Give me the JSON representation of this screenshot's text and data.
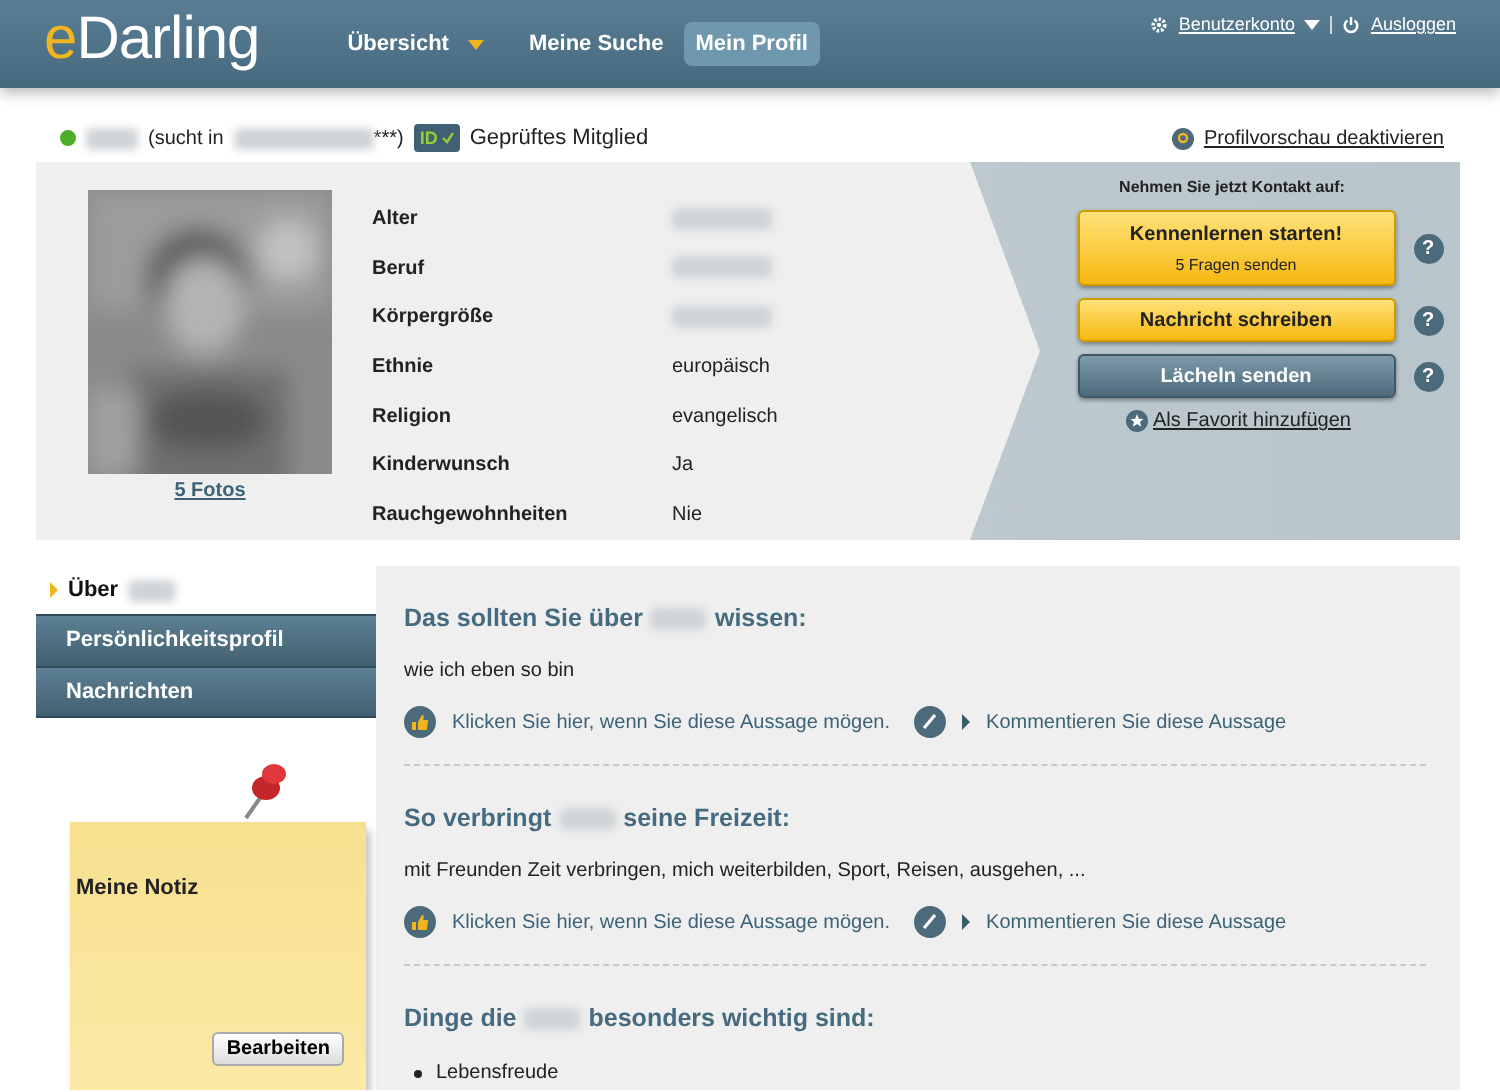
{
  "header": {
    "logo": [
      "e",
      "Darling"
    ],
    "nav": [
      {
        "label": "Übersicht",
        "selected": false,
        "dropdown": true
      },
      {
        "label": "Meine Suche",
        "selected": false,
        "dropdown": false
      },
      {
        "label": "Mein Profil",
        "selected": true,
        "dropdown": false
      }
    ],
    "account": "Benutzerkonto",
    "logout": "Ausloggen"
  },
  "status": {
    "online": true,
    "search_prefix": "(sucht in",
    "search_suffix": "***)",
    "id_badge": "ID",
    "verified": "Geprüftes Mitglied",
    "preview_link": "Profilvorschau deaktivieren"
  },
  "profile": {
    "photos_link": "5 Fotos",
    "attributes": [
      {
        "label": "Alter"
      },
      {
        "label": "Beruf"
      },
      {
        "label": "Körpergröße"
      },
      {
        "label": "Ethnie",
        "value": "europäisch"
      },
      {
        "label": "Religion",
        "value": "evangelisch"
      },
      {
        "label": "Kinderwunsch",
        "value": "Ja"
      },
      {
        "label": "Rauchgewohnheiten",
        "value": "Nie"
      }
    ],
    "contact": {
      "title": "Nehmen Sie jetzt Kontakt auf:",
      "buttons": [
        {
          "kind": "primary",
          "label": "Kennenlernen starten!",
          "sub": "5 Fragen senden",
          "help": "?"
        },
        {
          "kind": "primary",
          "label": "Nachricht schreiben",
          "help": "?"
        },
        {
          "kind": "secondary",
          "label": "Lächeln senden",
          "help": "?"
        }
      ],
      "favorite": "Als Favorit hinzufügen"
    }
  },
  "sidebar": {
    "items": [
      {
        "label": "Über",
        "selected": true
      },
      {
        "label": "Persönlichkeitsprofil",
        "selected": false
      },
      {
        "label": "Nachrichten",
        "selected": false
      }
    ],
    "note": {
      "title": "Meine Notiz",
      "button": "Bearbeiten"
    }
  },
  "sections": [
    {
      "heading": [
        "Das sollten Sie über",
        "wissen:"
      ],
      "text": "wie ich eben so bin",
      "like": "Klicken Sie hier, wenn Sie diese Aussage mögen.",
      "comment": "Kommentieren Sie diese Aussage"
    },
    {
      "heading": [
        "So verbringt",
        "seine Freizeit:"
      ],
      "text": "mit Freunden Zeit verbringen, mich weiterbilden, Sport, Reisen, ausgehen, ...",
      "like": "Klicken Sie hier, wenn Sie diese Aussage mögen.",
      "comment": "Kommentieren Sie diese Aussage"
    },
    {
      "heading": [
        "Dinge die",
        "besonders wichtig sind:"
      ],
      "list": [
        "Lebensfreude"
      ]
    }
  ]
}
